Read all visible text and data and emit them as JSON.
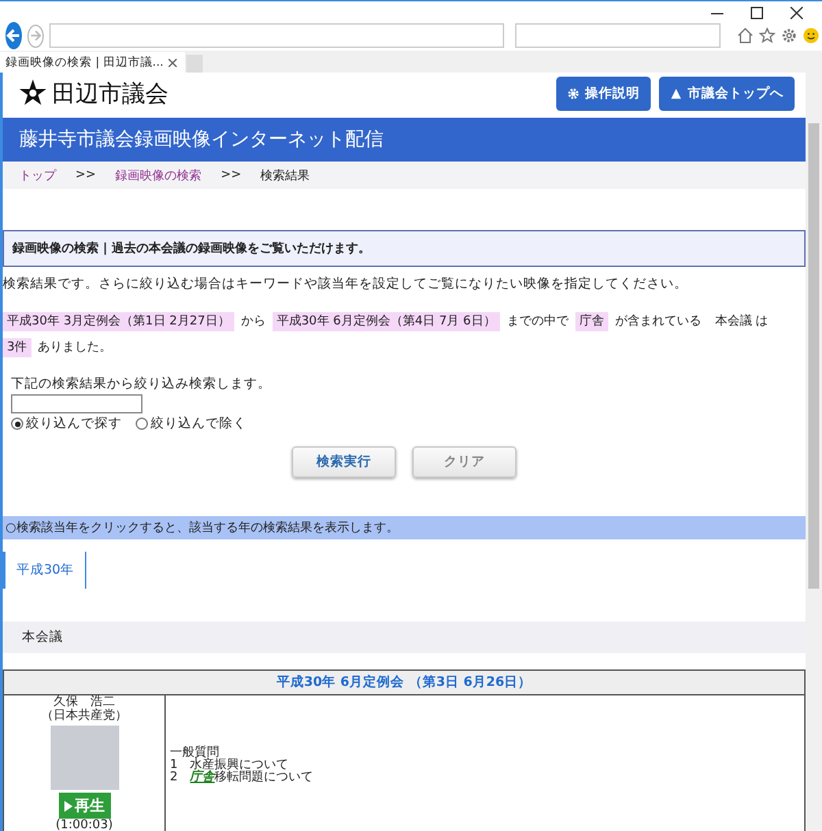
{
  "browser": {
    "tab_title": "録画映像の検索 | 田辺市議..."
  },
  "header": {
    "logo_text": "田辺市議会",
    "buttons": [
      {
        "label": "操作説明",
        "kind": "gear"
      },
      {
        "label": "市議会トップへ",
        "kind": "home"
      }
    ]
  },
  "banner": {
    "title": "藤井寺市議会録画映像インターネット配信"
  },
  "breadcrumb": [
    {
      "label": "トップ",
      "kind": "link"
    },
    {
      "label": ">>",
      "kind": "separator"
    },
    {
      "label": "録画映像の検索",
      "kind": "link"
    },
    {
      "label": ">>",
      "kind": "separator"
    },
    {
      "label": "検索結果",
      "kind": "current"
    }
  ],
  "section_heading": "録画映像の検索 | 過去の本会議の録画映像をご覧いただけます。",
  "intro": "検索結果です。さらに絞り込む場合はキーワードや該当年を設定してご覧になりたい映像を指定してください。",
  "summary": [
    {
      "text": "平成30年 3月定例会（第1日 2月27日）",
      "kind": "highlight"
    },
    {
      "text": "から",
      "kind": "plain"
    },
    {
      "text": "平成30年 6月定例会（第4日 7月 6日）",
      "kind": "highlight"
    },
    {
      "text": "までの中で",
      "kind": "plain"
    },
    {
      "text": "庁舎",
      "kind": "highlight"
    },
    {
      "text": "が含まれている",
      "kind": "plain"
    },
    {
      "text": "本会議 は",
      "kind": "plain"
    },
    {
      "text": "3件",
      "kind": "highlight"
    },
    {
      "text": "ありました。",
      "kind": "plain"
    }
  ],
  "filter": {
    "label": "下記の検索結果から絞り込み検索します。",
    "radios": [
      {
        "label": "絞り込んで探す",
        "selected": true
      },
      {
        "label": "絞り込んで除く",
        "selected": false
      }
    ],
    "buttons": [
      {
        "label": "検索実行",
        "kind": "primary"
      },
      {
        "label": "クリア",
        "kind": "secondary"
      }
    ]
  },
  "notice": "○検索該当年をクリックすると、該当する年の検索結果を表示します。",
  "year_tabs": [
    {
      "label": "平成30年",
      "selected": true
    }
  ],
  "category": "本会議",
  "result": {
    "title": "平成30年 6月定例会 （第3日 6月26日）",
    "speaker": "久保　浩二",
    "party": "（日本共産党）",
    "play_button": "再生",
    "duration": "(1:00:03)",
    "lines": [
      "一般質問",
      "1　水産振興について",
      "2　**庁舎**移転問題について"
    ]
  }
}
